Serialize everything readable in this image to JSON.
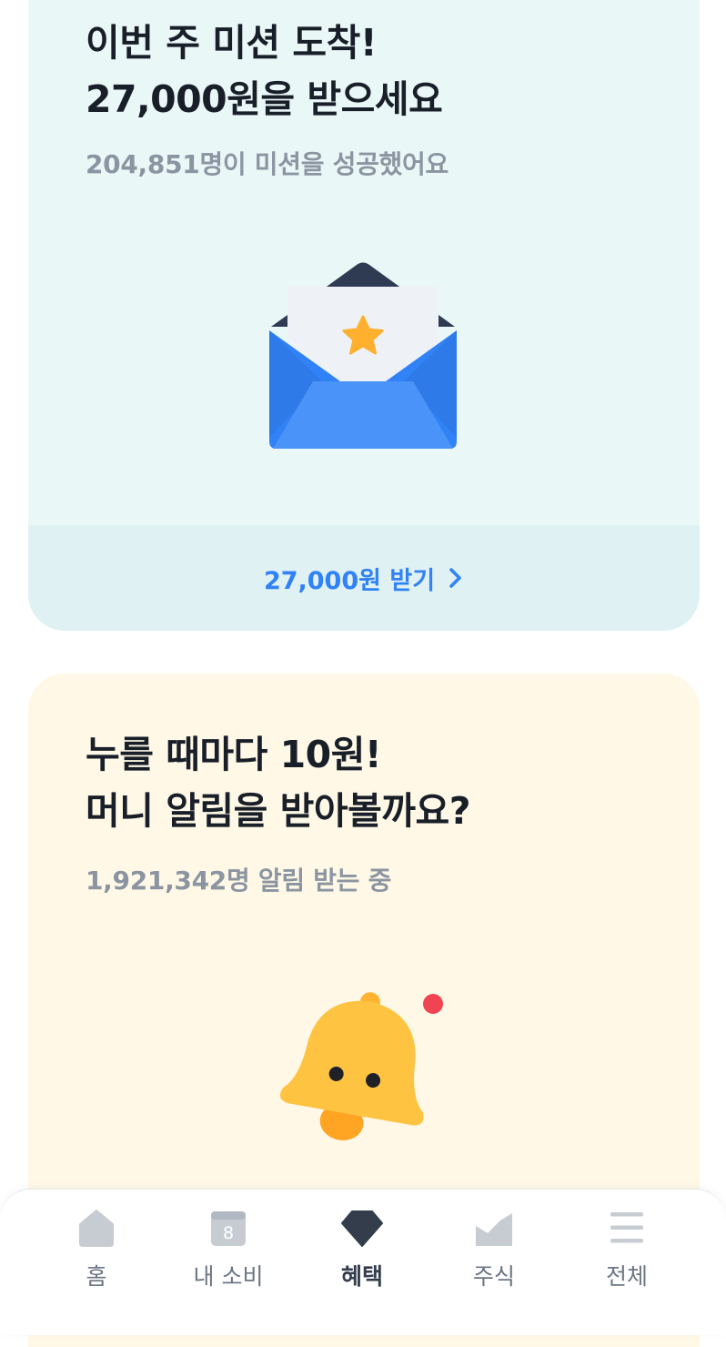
{
  "mission_card": {
    "title_line1": "이번 주 미션 도착!",
    "title_line2": "27,000원을 받으세요",
    "subtitle": "204,851명이 미션을 성공했어요",
    "cta_label": "27,000원 받기",
    "icon": "envelope-star-icon"
  },
  "alarm_card": {
    "title_line1": "누를 때마다 10원!",
    "title_line2": "머니 알림을 받아볼까요?",
    "subtitle": "1,921,342명 알림 받는 중",
    "icon": "bell-icon"
  },
  "tabbar": {
    "tabs": [
      {
        "label": "홈",
        "icon": "home-icon"
      },
      {
        "label": "내 소비",
        "icon": "calendar-icon",
        "icon_text": "8"
      },
      {
        "label": "혜택",
        "icon": "gem-icon",
        "active": true
      },
      {
        "label": "주식",
        "icon": "stock-chart-icon"
      },
      {
        "label": "전체",
        "icon": "menu-icon"
      }
    ]
  },
  "colors": {
    "mission_bg": "#eaf7f7",
    "mission_footer_bg": "#dff1f2",
    "alarm_bg": "#fff8e6",
    "accent_blue": "#3182f6",
    "title_text": "#191f28",
    "sub_text": "#8b95a1"
  }
}
